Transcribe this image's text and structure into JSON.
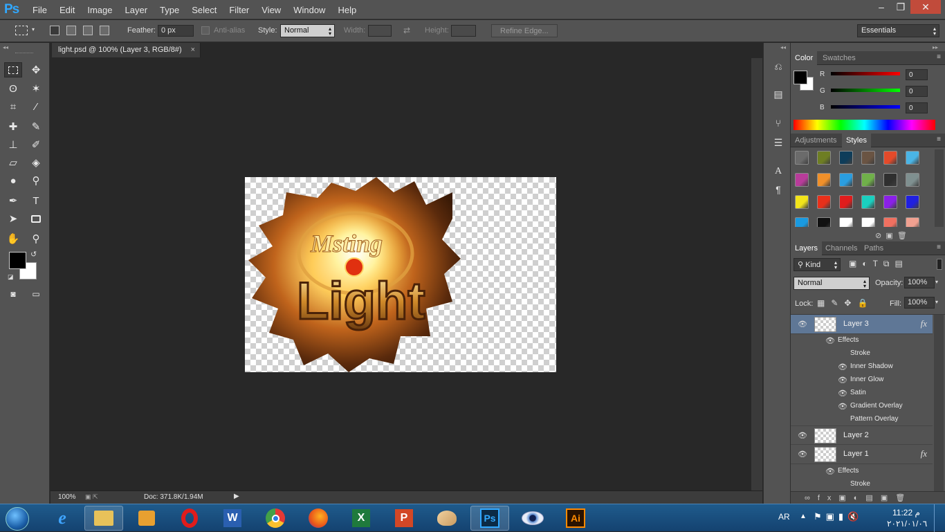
{
  "app": {
    "logo": "Ps"
  },
  "menu": [
    "File",
    "Edit",
    "Image",
    "Layer",
    "Type",
    "Select",
    "Filter",
    "View",
    "Window",
    "Help"
  ],
  "window_buttons": {
    "minimize": "–",
    "maximize": "❐",
    "close": "✕"
  },
  "options": {
    "feather_label": "Feather:",
    "feather_value": "0 px",
    "antialias_label": "Anti-alias",
    "style_label": "Style:",
    "style_value": "Normal",
    "width_label": "Width:",
    "height_label": "Height:",
    "refine_edge": "Refine Edge...",
    "workspace": "Essentials"
  },
  "document": {
    "tab_title": "light.psd @ 100% (Layer 3, RGB/8#)",
    "tab_close": "×",
    "zoom": "100%",
    "doc_size": "Doc: 371.8K/1.94M"
  },
  "color_panel": {
    "tabs": [
      "Color",
      "Swatches"
    ],
    "channels": [
      {
        "label": "R",
        "value": "0",
        "color": "#e02020"
      },
      {
        "label": "G",
        "value": "0",
        "color": "#20c020"
      },
      {
        "label": "B",
        "value": "0",
        "color": "#2040e0"
      }
    ]
  },
  "styles_panel": {
    "tabs": [
      "Adjustments",
      "Styles"
    ],
    "swatches": [
      "#6b6b6b",
      "#6e7e23",
      "#0e3d5a",
      "#6a5443",
      "#e44a2a",
      "#4ab5e6",
      "#b83c9a",
      "#f0902a",
      "#2a9ee0",
      "#70b04a",
      "#2f2f2f",
      "#7f9090",
      "#f2e41a",
      "#e8301a",
      "#e01c1c",
      "#1ad0c0",
      "#8a20e8",
      "#2020e0",
      "#1a9ae0",
      "#111111",
      "#ffffff",
      "#ffffff",
      "#f07060",
      "#f0a090"
    ]
  },
  "layers_panel": {
    "tabs": [
      "Layers",
      "Channels",
      "Paths"
    ],
    "kind": "Kind",
    "blend_mode": "Normal",
    "opacity_label": "Opacity:",
    "opacity_value": "100%",
    "lock_label": "Lock:",
    "fill_label": "Fill:",
    "fill_value": "100%",
    "fx_label": "fx",
    "layer3": "Layer 3",
    "layer3_effects_label": "Effects",
    "layer3_effects": [
      "Stroke",
      "Inner Shadow",
      "Inner Glow",
      "Satin",
      "Gradient Overlay",
      "Pattern Overlay"
    ],
    "layer2": "Layer 2",
    "layer1": "Layer 1",
    "layer1_effects_label": "Effects",
    "layer1_effects": [
      "Stroke"
    ]
  },
  "taskbar": {
    "lang": "AR",
    "time": "11:22 م",
    "date": "٢٠٢١/٠١/٠٦"
  }
}
